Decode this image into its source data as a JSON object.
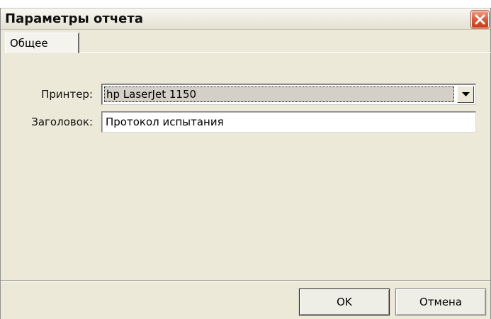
{
  "window": {
    "title": "Параметры отчета",
    "close_icon": "close-icon"
  },
  "tabs": [
    {
      "label": "Общее",
      "active": true
    }
  ],
  "form": {
    "printer_label": "Принтер:",
    "printer_value": "hp LaserJet 1150",
    "heading_label": "Заголовок:",
    "heading_value": "Протокол испытания"
  },
  "buttons": {
    "ok_label": "OK",
    "cancel_label": "Отмена"
  },
  "colors": {
    "face": "#ece9d8",
    "close_accent": "#dc5434"
  }
}
